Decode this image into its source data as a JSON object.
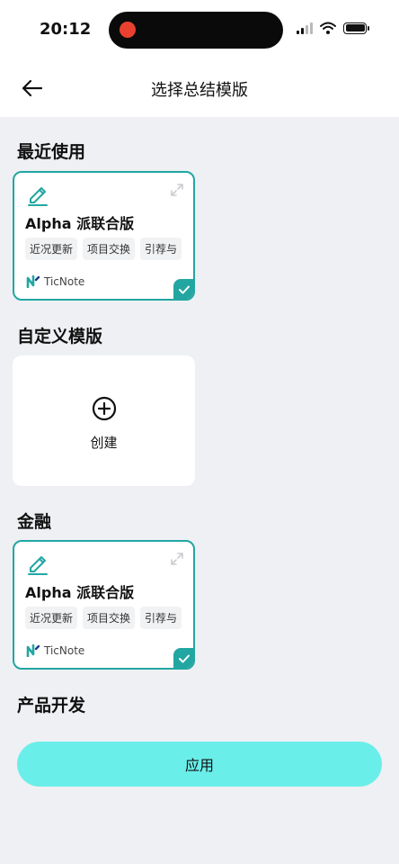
{
  "status_bar": {
    "time": "20:12"
  },
  "header": {
    "title": "选择总结模版"
  },
  "sections": {
    "recent": {
      "title": "最近使用",
      "card": {
        "name": "Alpha 派联合版",
        "tags": [
          "近况更新",
          "项目交换",
          "引荐与"
        ],
        "brand": "TicNote",
        "selected": true
      }
    },
    "custom": {
      "title": "自定义模版",
      "create_label": "创建"
    },
    "finance": {
      "title": "金融",
      "card": {
        "name": "Alpha 派联合版",
        "tags": [
          "近况更新",
          "项目交换",
          "引荐与"
        ],
        "brand": "TicNote",
        "selected": true
      }
    },
    "product": {
      "title": "产品开发"
    }
  },
  "apply_button": {
    "label": "应用"
  },
  "colors": {
    "accent": "#22a6a2",
    "apply_button": "#6aeeea",
    "background": "#eef0f4",
    "recording_dot": "#e8412f"
  },
  "icons": {
    "back": "arrow-left-icon",
    "edit": "pencil-icon",
    "expand": "expand-icon",
    "create": "plus-circle-icon",
    "selected": "checkmark-icon",
    "brand": "ticnote-logo"
  }
}
